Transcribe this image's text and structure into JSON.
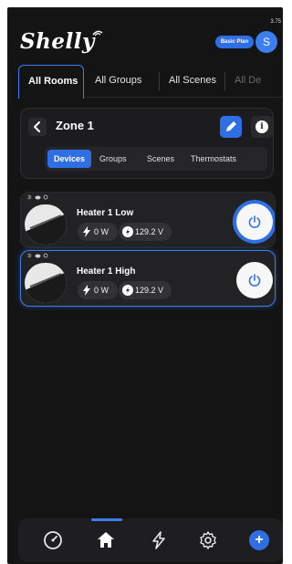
{
  "status": {
    "value": "3.75"
  },
  "header": {
    "logo_text": "Shelly",
    "plan_badge": "Basic Plan",
    "avatar_initial": "S"
  },
  "tabs": [
    {
      "label": "All Rooms",
      "active": true
    },
    {
      "label": "All Groups",
      "active": false
    },
    {
      "label": "All Scenes",
      "active": false
    },
    {
      "label": "All De",
      "active": false
    }
  ],
  "zone": {
    "title": "Zone 1",
    "subtabs": [
      {
        "label": "Devices",
        "active": true
      },
      {
        "label": "Groups",
        "active": false
      },
      {
        "label": "Scenes",
        "active": false
      },
      {
        "label": "Thermostats",
        "active": false
      }
    ]
  },
  "devices": [
    {
      "name": "Heater 1 Low",
      "power": "0 W",
      "voltage": "129.2 V",
      "state": "on",
      "selected": false
    },
    {
      "name": "Heater 1 High",
      "power": "0 W",
      "voltage": "129.2 V",
      "state": "off",
      "selected": true
    }
  ],
  "bottom_nav": {
    "items": [
      "dashboard-icon",
      "home-icon",
      "energy-icon",
      "settings-icon",
      "add-icon"
    ],
    "active": "home-icon",
    "add_symbol": "+"
  },
  "colors": {
    "accent": "#2f6fe4",
    "background": "#141415",
    "card": "#222224"
  }
}
